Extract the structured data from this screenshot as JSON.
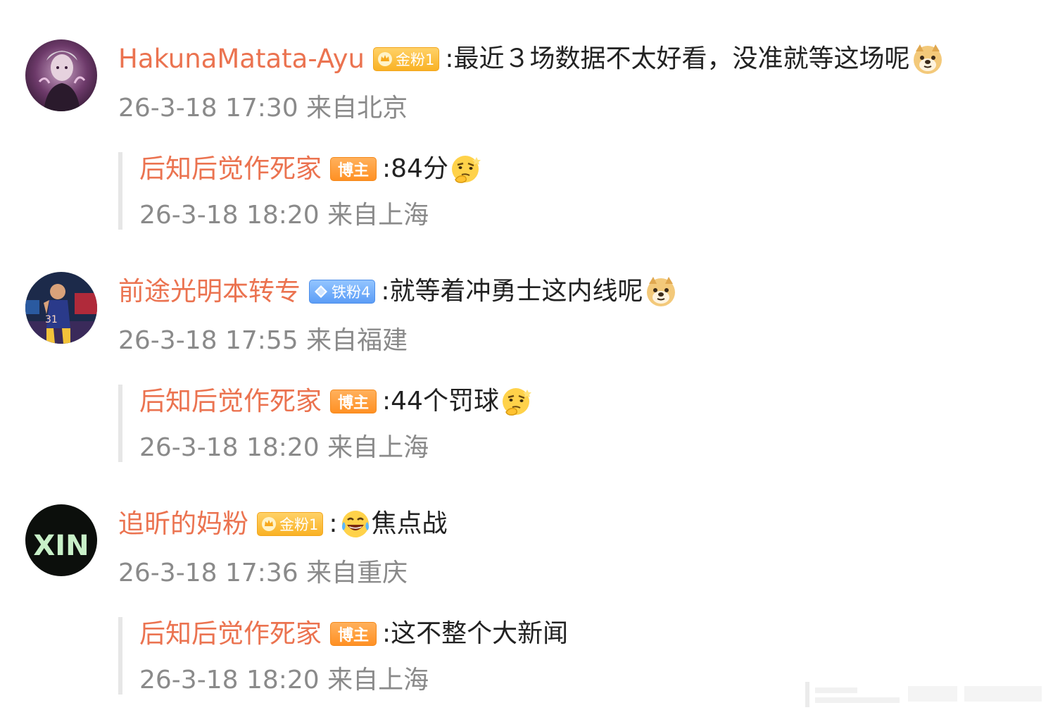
{
  "comments": [
    {
      "avatar": "avatar-gothic-figure",
      "username": "HakunaMatata-Ayu",
      "badge": {
        "type": "gold-fan",
        "label": "金粉1",
        "icon": "crown-icon"
      },
      "separator": ":",
      "text": "最近３场数据不太好看，没准就等这场呢",
      "emoji": "doge-emoji",
      "meta": "26-3-18 17:30 来自北京",
      "reply": {
        "username": "后知后觉作死家",
        "badge": {
          "type": "host",
          "label": "博主"
        },
        "separator": ":",
        "text": "84分",
        "emoji": "thinking-emoji",
        "meta": "26-3-18 18:20 来自上海"
      }
    },
    {
      "avatar": "avatar-basketball-player",
      "username": "前途光明本转专",
      "badge": {
        "type": "iron-fan",
        "label": "铁粉4",
        "icon": "diamond-icon"
      },
      "separator": ":",
      "text": "就等着冲勇士这内线呢",
      "emoji": "doge-emoji",
      "meta": "26-3-18 17:55 来自福建",
      "reply": {
        "username": "后知后觉作死家",
        "badge": {
          "type": "host",
          "label": "博主"
        },
        "separator": ":",
        "text": "44个罚球",
        "emoji": "thinking-emoji",
        "meta": "26-3-18 18:20 来自上海"
      }
    },
    {
      "avatar": "avatar-xin-text",
      "avatar_text": "XIN",
      "username": "追昕的妈粉",
      "badge": {
        "type": "gold-fan",
        "label": "金粉1",
        "icon": "crown-icon"
      },
      "separator": ":",
      "leading_emoji": "laugh-cry-emoji",
      "text": "焦点战",
      "meta": "26-3-18 17:36 来自重庆",
      "reply": {
        "username": "后知后觉作死家",
        "badge": {
          "type": "host",
          "label": "博主"
        },
        "separator": ":",
        "text": "这不整个大新闻",
        "meta": "26-3-18 18:20 来自上海"
      }
    }
  ],
  "colors": {
    "username": "#eb7350",
    "meta": "#8a8a8a",
    "gold_badge": "#f9b224",
    "iron_badge": "#5c9df6",
    "host_badge": "#ff9124",
    "reply_bar": "#e6e6e6"
  }
}
